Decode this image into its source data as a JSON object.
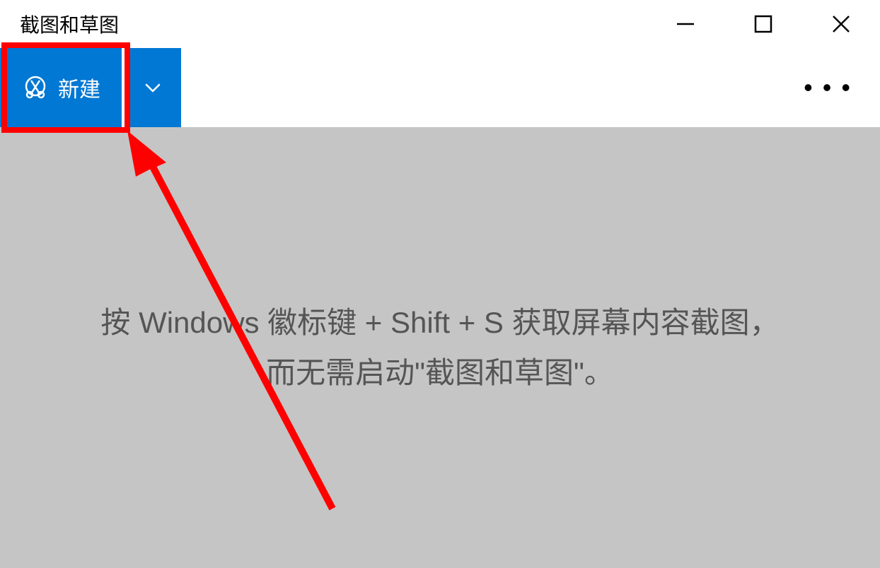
{
  "window": {
    "title": "截图和草图"
  },
  "toolbar": {
    "new_button_label": "新建"
  },
  "content": {
    "hint_line1": "按 Windows 徽标键 + Shift + S 获取屏幕内容截图，",
    "hint_line2": "而无需启动\"截图和草图\"。"
  },
  "colors": {
    "accent": "#0078d4",
    "highlight": "#ff0000",
    "content_bg": "#c5c5c5"
  }
}
